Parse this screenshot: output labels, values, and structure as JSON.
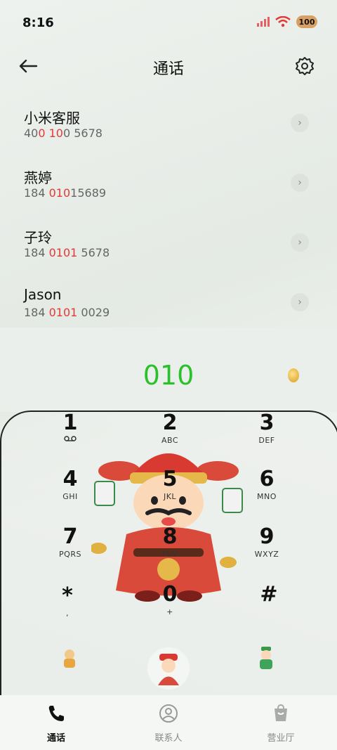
{
  "status_bar": {
    "time": "8:16",
    "battery": "100",
    "icons": [
      "signal-icon",
      "wifi-icon",
      "battery-icon"
    ]
  },
  "header": {
    "title": "通话",
    "back_icon": "back-arrow-icon",
    "settings_icon": "gear-icon"
  },
  "contacts": [
    {
      "name": "小米客服",
      "number_pre": "40",
      "number_hl": "0 10",
      "number_post": "0 5678"
    },
    {
      "name": "燕婷",
      "number_pre": "184 ",
      "number_hl": "010",
      "number_post": "15689"
    },
    {
      "name": "子玲",
      "number_pre": "184 ",
      "number_hl": "0101",
      "number_post": " 5678"
    },
    {
      "name": "Jason",
      "number_pre": "184 ",
      "number_hl": "0101",
      "number_post": " 0029"
    }
  ],
  "dialed_number": "010",
  "keys": [
    {
      "digit": "1",
      "letters": ""
    },
    {
      "digit": "2",
      "letters": "ABC"
    },
    {
      "digit": "3",
      "letters": "DEF"
    },
    {
      "digit": "4",
      "letters": "GHI"
    },
    {
      "digit": "5",
      "letters": "JKL"
    },
    {
      "digit": "6",
      "letters": "MNO"
    },
    {
      "digit": "7",
      "letters": "PQRS"
    },
    {
      "digit": "8",
      "letters": "TUV"
    },
    {
      "digit": "9",
      "letters": "WXYZ"
    },
    {
      "digit": "*",
      "letters": ","
    },
    {
      "digit": "0",
      "letters": "+"
    },
    {
      "digit": "#",
      "letters": ""
    }
  ],
  "bottom_nav": [
    {
      "label": "通话",
      "icon": "phone-icon",
      "active": true
    },
    {
      "label": "联系人",
      "icon": "person-icon",
      "active": false
    },
    {
      "label": "营业厅",
      "icon": "bag-icon",
      "active": false
    }
  ],
  "colors": {
    "accent_green": "#2bc12b",
    "highlight_red": "#e53935"
  }
}
